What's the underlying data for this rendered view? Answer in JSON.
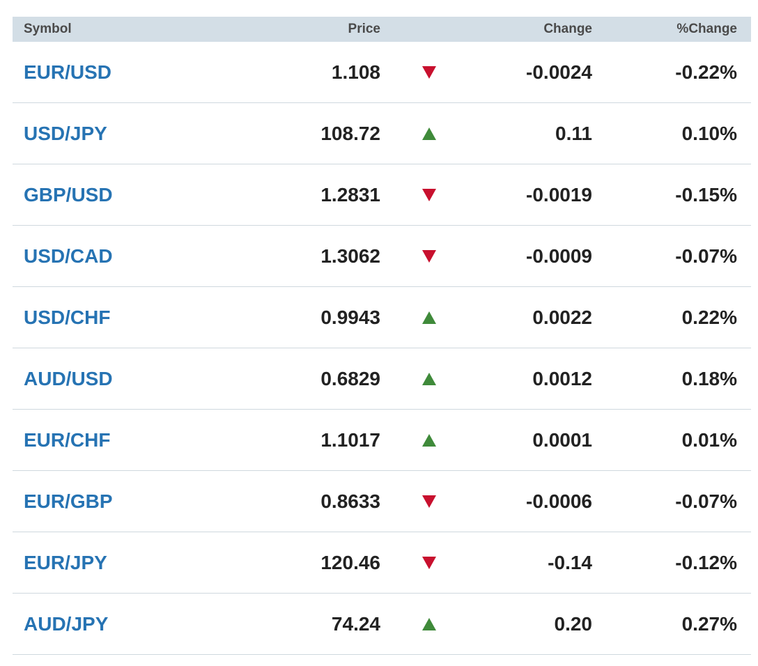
{
  "header": {
    "symbol": "Symbol",
    "price": "Price",
    "change": "Change",
    "pct_change": "%Change"
  },
  "rows": [
    {
      "symbol": "EUR/USD",
      "price": "1.108",
      "direction": "down",
      "change": "-0.0024",
      "pct": "-0.22%"
    },
    {
      "symbol": "USD/JPY",
      "price": "108.72",
      "direction": "up",
      "change": "0.11",
      "pct": "0.10%"
    },
    {
      "symbol": "GBP/USD",
      "price": "1.2831",
      "direction": "down",
      "change": "-0.0019",
      "pct": "-0.15%"
    },
    {
      "symbol": "USD/CAD",
      "price": "1.3062",
      "direction": "down",
      "change": "-0.0009",
      "pct": "-0.07%"
    },
    {
      "symbol": "USD/CHF",
      "price": "0.9943",
      "direction": "up",
      "change": "0.0022",
      "pct": "0.22%"
    },
    {
      "symbol": "AUD/USD",
      "price": "0.6829",
      "direction": "up",
      "change": "0.0012",
      "pct": "0.18%"
    },
    {
      "symbol": "EUR/CHF",
      "price": "1.1017",
      "direction": "up",
      "change": "0.0001",
      "pct": "0.01%"
    },
    {
      "symbol": "EUR/GBP",
      "price": "0.8633",
      "direction": "down",
      "change": "-0.0006",
      "pct": "-0.07%"
    },
    {
      "symbol": "EUR/JPY",
      "price": "120.46",
      "direction": "down",
      "change": "-0.14",
      "pct": "-0.12%"
    },
    {
      "symbol": "AUD/JPY",
      "price": "74.24",
      "direction": "up",
      "change": "0.20",
      "pct": "0.27%"
    }
  ],
  "colors": {
    "header_bg": "#d3dee6",
    "symbol_link": "#2673b3",
    "down": "#c8102e",
    "up": "#3f8a3a"
  },
  "icons": {
    "down": "triangle-down-icon",
    "up": "triangle-up-icon"
  }
}
